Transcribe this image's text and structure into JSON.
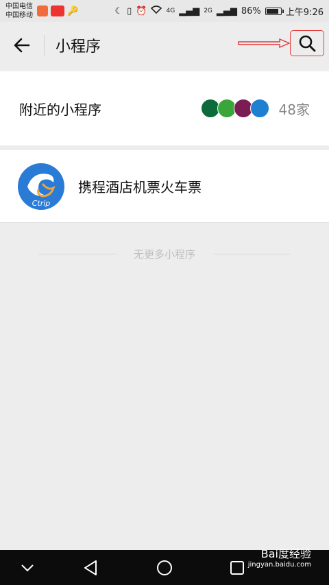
{
  "statusbar": {
    "carrier1": "中国电信",
    "carrier2": "中国移动",
    "net_4g": "4G",
    "net_2g": "2G",
    "battery_pct": "86%",
    "battery_level": 0.86,
    "time": "上午9:26"
  },
  "header": {
    "title": "小程序"
  },
  "nearby": {
    "label": "附近的小程序",
    "count": "48家"
  },
  "program": {
    "name": "携程酒店机票火车票",
    "logo_text": "Ctrip"
  },
  "footer_note": "无更多小程序",
  "watermark": {
    "brand": "Bai度经验",
    "url": "jingyan.baidu.com"
  },
  "colors": {
    "annotation_red": "#e23a3a",
    "ctrip_blue": "#2a7bd6"
  }
}
